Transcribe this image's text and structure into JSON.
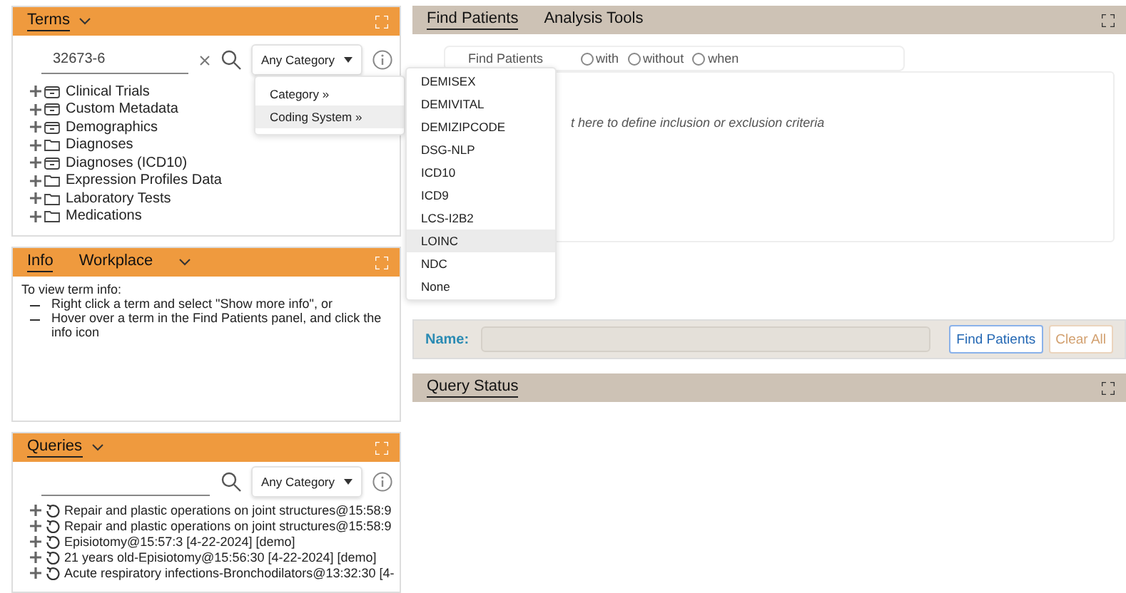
{
  "terms_panel": {
    "title": "Terms",
    "search": {
      "value": "32673-6"
    },
    "category_select": "Any Category",
    "tree": [
      {
        "label": "Clinical Trials",
        "kind": "container"
      },
      {
        "label": "Custom Metadata",
        "kind": "container"
      },
      {
        "label": "Demographics",
        "kind": "container"
      },
      {
        "label": "Diagnoses",
        "kind": "folder"
      },
      {
        "label": "Diagnoses (ICD10)",
        "kind": "container"
      },
      {
        "label": "Expression Profiles Data",
        "kind": "folder"
      },
      {
        "label": "Laboratory Tests",
        "kind": "folder"
      },
      {
        "label": "Medications",
        "kind": "folder"
      }
    ]
  },
  "category_menu": {
    "items": [
      {
        "label": "Category »",
        "selected": false
      },
      {
        "label": "Coding System »",
        "selected": true
      }
    ]
  },
  "coding_system_menu": {
    "items": [
      {
        "label": "DEMISEX",
        "selected": false
      },
      {
        "label": "DEMIVITAL",
        "selected": false
      },
      {
        "label": "DEMIZIPCODE",
        "selected": false
      },
      {
        "label": "DSG-NLP",
        "selected": false
      },
      {
        "label": "ICD10",
        "selected": false
      },
      {
        "label": "ICD9",
        "selected": false
      },
      {
        "label": "LCS-I2B2",
        "selected": false
      },
      {
        "label": "LOINC",
        "selected": true
      },
      {
        "label": "NDC",
        "selected": false
      },
      {
        "label": "None",
        "selected": false
      }
    ]
  },
  "info_panel": {
    "tabs": [
      {
        "label": "Info",
        "selected": true
      },
      {
        "label": "Workplace",
        "selected": false
      }
    ],
    "intro": "To view term info:",
    "bullets": [
      "Right click a term and select \"Show more info\", or",
      "Hover over a term in the Find Patients panel, and click the info icon"
    ]
  },
  "queries_panel": {
    "title": "Queries",
    "category_select": "Any Category",
    "items": [
      "Repair and plastic operations on joint structures@15:58:9",
      "Repair and plastic operations on joint structures@15:58:9",
      "Episiotomy@15:57:3 [4-22-2024] [demo]",
      "21 years old-Episiotomy@15:56:30 [4-22-2024] [demo]",
      "Acute respiratory infections-Bronchodilators@13:32:30 [4-"
    ]
  },
  "find_panel": {
    "tabs": [
      {
        "label": "Find Patients",
        "selected": true
      },
      {
        "label": "Analysis Tools",
        "selected": false
      }
    ],
    "mode_label": "Find Patients",
    "modes": [
      {
        "label": "with",
        "selected": false
      },
      {
        "label": "without",
        "selected": false
      },
      {
        "label": "when",
        "selected": false
      }
    ],
    "drop_hint": "t here to define inclusion or exclusion criteria",
    "name_label": "Name:",
    "buttons": [
      {
        "label": "Find Patients",
        "kind": "primary"
      },
      {
        "label": "Clear All",
        "kind": "secondary"
      }
    ]
  },
  "status_panel": {
    "title": "Query Status"
  }
}
